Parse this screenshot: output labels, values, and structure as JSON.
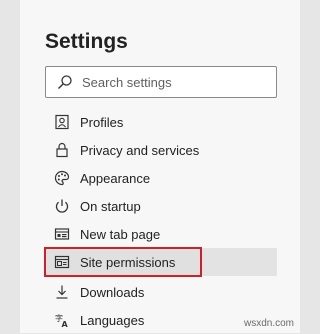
{
  "header": {
    "title": "Settings"
  },
  "search": {
    "placeholder": "Search settings",
    "icon": "search-icon"
  },
  "nav": {
    "items": [
      {
        "label": "Profiles",
        "icon": "profile-icon"
      },
      {
        "label": "Privacy and services",
        "icon": "lock-icon"
      },
      {
        "label": "Appearance",
        "icon": "palette-icon"
      },
      {
        "label": "On startup",
        "icon": "power-icon"
      },
      {
        "label": "New tab page",
        "icon": "new-tab-icon"
      },
      {
        "label": "Site permissions",
        "icon": "site-permissions-icon",
        "selected": true
      },
      {
        "label": "Downloads",
        "icon": "download-icon"
      },
      {
        "label": "Languages",
        "icon": "language-icon"
      }
    ]
  },
  "colors": {
    "highlight_outline": "#cf2027",
    "selected_bg": "#e3e3e3"
  },
  "watermark": "wsxdn.com"
}
